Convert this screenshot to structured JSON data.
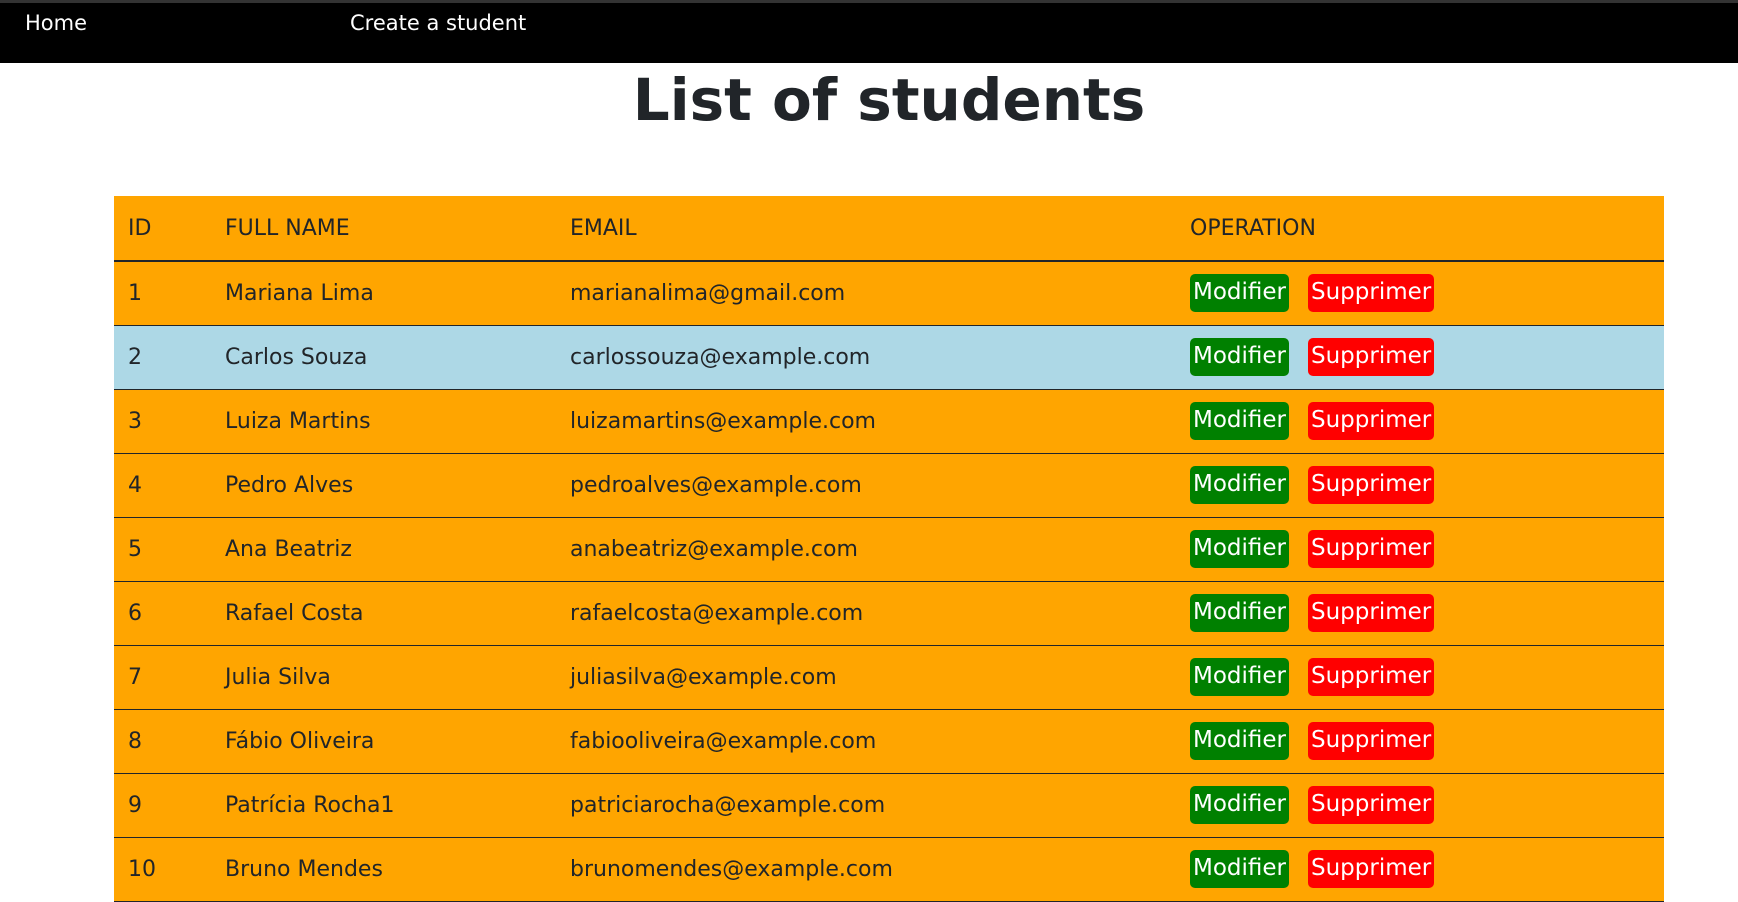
{
  "nav": {
    "home_label": "Home",
    "create_label": "Create a student"
  },
  "page": {
    "title": "List of students"
  },
  "table": {
    "headers": {
      "id": "ID",
      "full_name": "FULL NAME",
      "email": "EMAIL",
      "operation": "OPERATION"
    },
    "rows": [
      {
        "id": "1",
        "name": "Mariana Lima",
        "email": "marianalima@gmail.com"
      },
      {
        "id": "2",
        "name": "Carlos Souza",
        "email": "carlossouza@example.com"
      },
      {
        "id": "3",
        "name": "Luiza Martins",
        "email": "luizamartins@example.com"
      },
      {
        "id": "4",
        "name": "Pedro Alves",
        "email": "pedroalves@example.com"
      },
      {
        "id": "5",
        "name": "Ana Beatriz",
        "email": "anabeatriz@example.com"
      },
      {
        "id": "6",
        "name": "Rafael Costa",
        "email": "rafaelcosta@example.com"
      },
      {
        "id": "7",
        "name": "Julia Silva",
        "email": "juliasilva@example.com"
      },
      {
        "id": "8",
        "name": "Fábio Oliveira",
        "email": "fabiooliveira@example.com"
      },
      {
        "id": "9",
        "name": "Patrícia Rocha1",
        "email": "patriciarocha@example.com"
      },
      {
        "id": "10",
        "name": "Bruno Mendes",
        "email": "brunomendes@example.com"
      }
    ],
    "modify_label": "Modifier",
    "delete_label": "Supprimer"
  },
  "colors": {
    "navbar": "#000000",
    "row_background": "#ffa500",
    "row_hover": "#add8e6",
    "modify_button": "#008000",
    "delete_button": "#ff0000"
  }
}
